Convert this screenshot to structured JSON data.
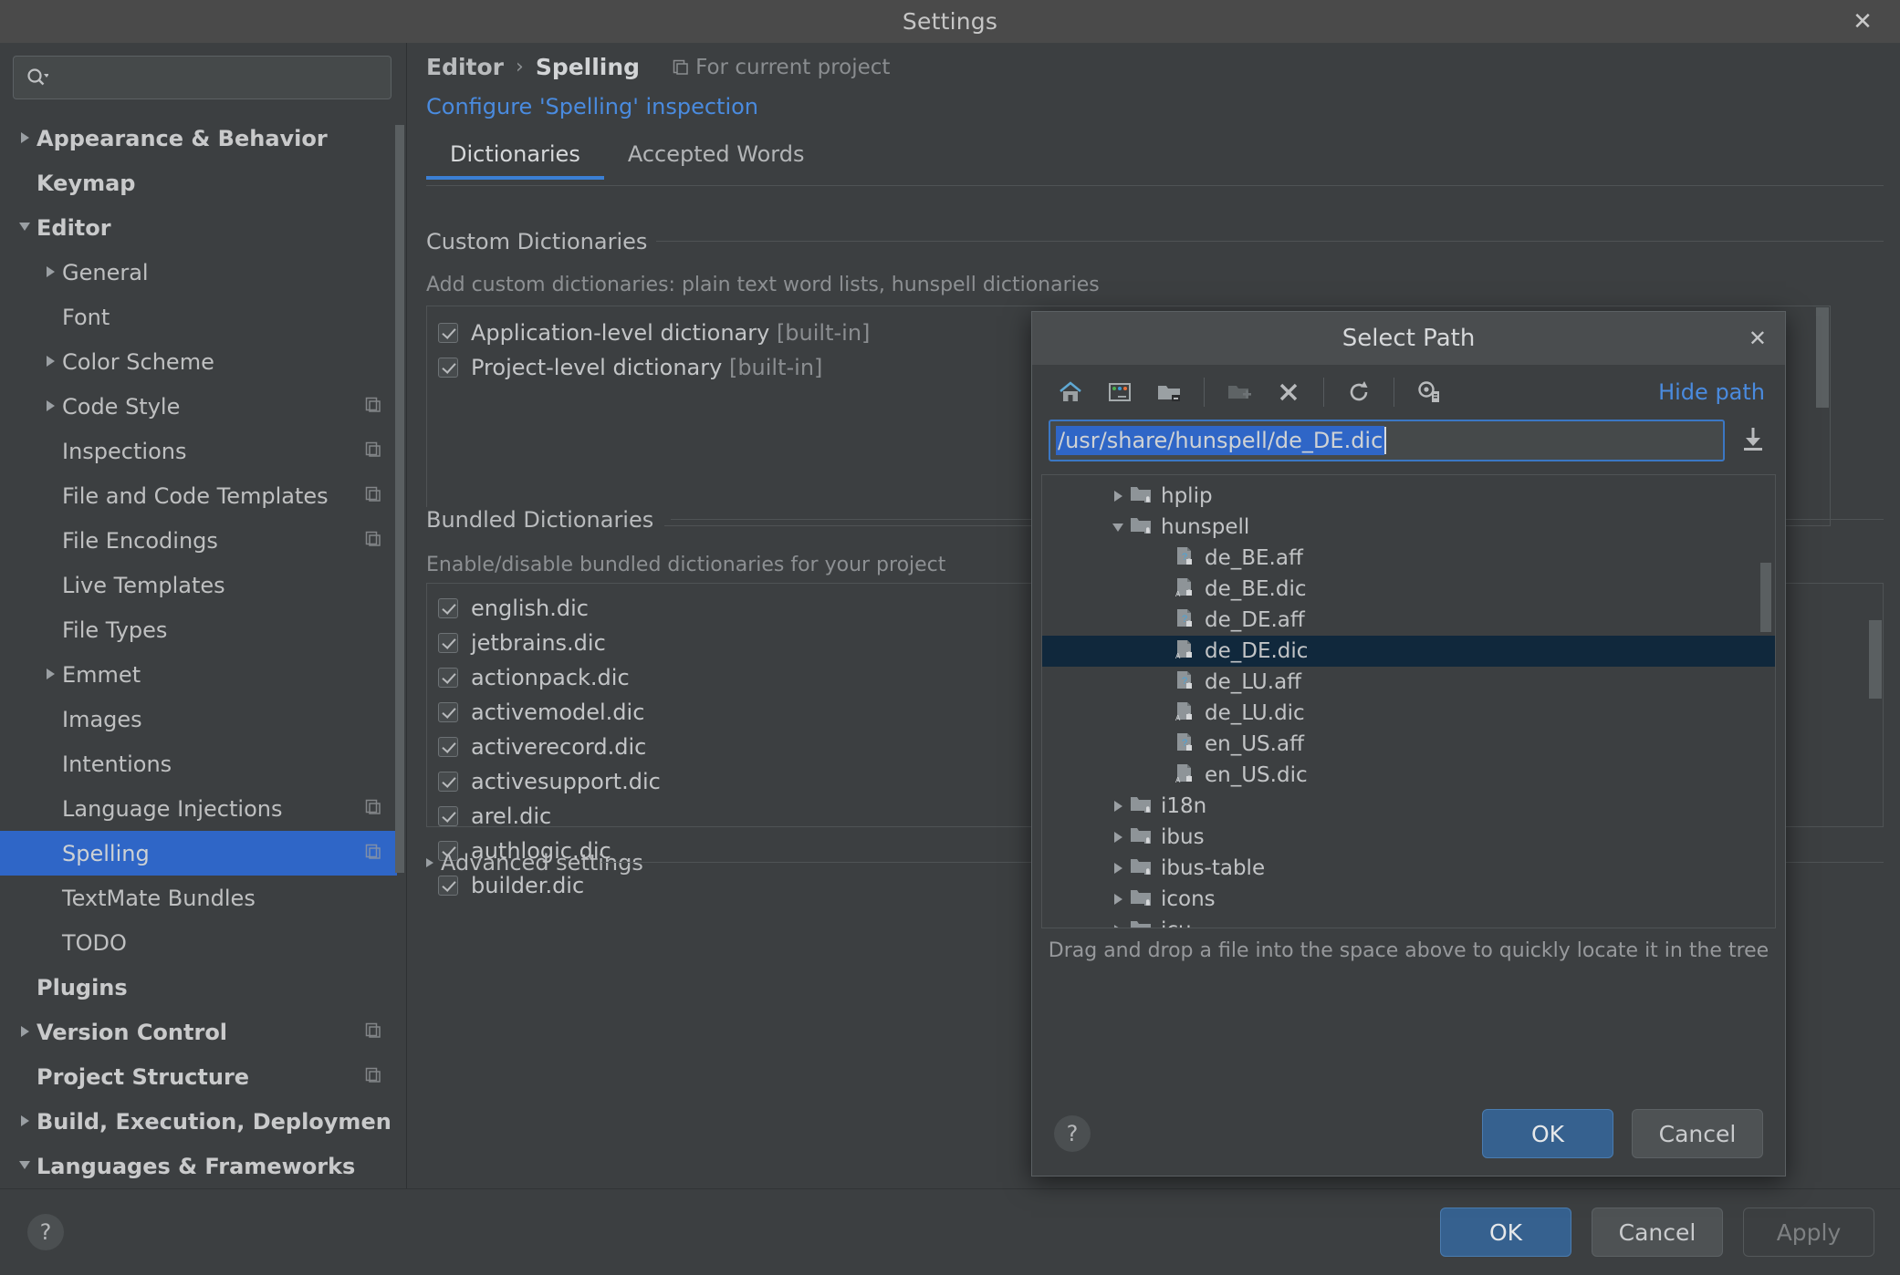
{
  "window": {
    "title": "Settings",
    "close_label": "✕"
  },
  "search": {
    "placeholder": "",
    "value": "",
    "icon": "search-icon"
  },
  "sidebar": {
    "items": [
      {
        "label": "Appearance & Behavior",
        "level": 0,
        "arrow": "closed",
        "copy": false,
        "selected": false
      },
      {
        "label": "Keymap",
        "level": 0,
        "arrow": "none",
        "copy": false,
        "selected": false
      },
      {
        "label": "Editor",
        "level": 0,
        "arrow": "open",
        "copy": false,
        "selected": false
      },
      {
        "label": "General",
        "level": 1,
        "arrow": "closed",
        "copy": false,
        "selected": false
      },
      {
        "label": "Font",
        "level": 1,
        "arrow": "none",
        "copy": false,
        "selected": false
      },
      {
        "label": "Color Scheme",
        "level": 1,
        "arrow": "closed",
        "copy": false,
        "selected": false
      },
      {
        "label": "Code Style",
        "level": 1,
        "arrow": "closed",
        "copy": true,
        "selected": false
      },
      {
        "label": "Inspections",
        "level": 1,
        "arrow": "none",
        "copy": true,
        "selected": false
      },
      {
        "label": "File and Code Templates",
        "level": 1,
        "arrow": "none",
        "copy": true,
        "selected": false
      },
      {
        "label": "File Encodings",
        "level": 1,
        "arrow": "none",
        "copy": true,
        "selected": false
      },
      {
        "label": "Live Templates",
        "level": 1,
        "arrow": "none",
        "copy": false,
        "selected": false
      },
      {
        "label": "File Types",
        "level": 1,
        "arrow": "none",
        "copy": false,
        "selected": false
      },
      {
        "label": "Emmet",
        "level": 1,
        "arrow": "closed",
        "copy": false,
        "selected": false
      },
      {
        "label": "Images",
        "level": 1,
        "arrow": "none",
        "copy": false,
        "selected": false
      },
      {
        "label": "Intentions",
        "level": 1,
        "arrow": "none",
        "copy": false,
        "selected": false
      },
      {
        "label": "Language Injections",
        "level": 1,
        "arrow": "none",
        "copy": true,
        "selected": false
      },
      {
        "label": "Spelling",
        "level": 1,
        "arrow": "none",
        "copy": true,
        "selected": true
      },
      {
        "label": "TextMate Bundles",
        "level": 1,
        "arrow": "none",
        "copy": false,
        "selected": false
      },
      {
        "label": "TODO",
        "level": 1,
        "arrow": "none",
        "copy": false,
        "selected": false
      },
      {
        "label": "Plugins",
        "level": 0,
        "arrow": "none",
        "copy": false,
        "selected": false
      },
      {
        "label": "Version Control",
        "level": 0,
        "arrow": "closed",
        "copy": true,
        "selected": false
      },
      {
        "label": "Project Structure",
        "level": 0,
        "arrow": "none",
        "copy": true,
        "selected": false
      },
      {
        "label": "Build, Execution, Deploymen",
        "level": 0,
        "arrow": "closed",
        "copy": false,
        "selected": false
      },
      {
        "label": "Languages & Frameworks",
        "level": 0,
        "arrow": "open",
        "copy": false,
        "selected": false
      }
    ]
  },
  "main": {
    "breadcrumb": {
      "parent": "Editor",
      "separator": "›",
      "current": "Spelling"
    },
    "for_current_project": "For current project",
    "configure_link": "Configure 'Spelling' inspection",
    "tabs": [
      {
        "label": "Dictionaries",
        "active": true
      },
      {
        "label": "Accepted Words",
        "active": false
      }
    ],
    "custom_dictionaries": {
      "title": "Custom Dictionaries",
      "hint": "Add custom dictionaries: plain text word lists, hunspell dictionaries",
      "items": [
        {
          "name": "Application-level dictionary",
          "suffix": " [built-in]",
          "checked": true
        },
        {
          "name": "Project-level dictionary",
          "suffix": " [built-in]",
          "checked": true
        }
      ],
      "buttons": [
        {
          "icon": "plus-icon",
          "glyph": "+",
          "selected": true
        },
        {
          "icon": "minus-icon",
          "glyph": "–",
          "selected": false
        },
        {
          "icon": "pencil-icon",
          "glyph": "✎",
          "selected": false
        }
      ]
    },
    "bundled_dictionaries": {
      "title": "Bundled Dictionaries",
      "hint": "Enable/disable bundled dictionaries for your project",
      "items": [
        {
          "name": "english.dic",
          "checked": true
        },
        {
          "name": "jetbrains.dic",
          "checked": true
        },
        {
          "name": "actionpack.dic",
          "checked": true
        },
        {
          "name": "activemodel.dic",
          "checked": true
        },
        {
          "name": "activerecord.dic",
          "checked": true
        },
        {
          "name": "activesupport.dic",
          "checked": true
        },
        {
          "name": "arel.dic",
          "checked": true
        },
        {
          "name": "authlogic.dic",
          "checked": true
        },
        {
          "name": "builder.dic",
          "checked": true
        }
      ]
    },
    "advanced_settings": "Advanced settings"
  },
  "footer": {
    "help_label": "?",
    "ok": "OK",
    "cancel": "Cancel",
    "apply": "Apply"
  },
  "dialog": {
    "title": "Select Path",
    "close_label": "✕",
    "toolbar": [
      {
        "icon": "home-icon",
        "name": "home-directory-button"
      },
      {
        "icon": "desktop-icon",
        "name": "desktop-directory-button"
      },
      {
        "icon": "project-folder-icon",
        "name": "project-directory-button"
      },
      {
        "icon": "new-folder-icon",
        "name": "new-folder-button"
      },
      {
        "icon": "delete-icon",
        "name": "delete-button"
      },
      {
        "icon": "refresh-icon",
        "name": "refresh-button"
      },
      {
        "icon": "show-hidden-icon",
        "name": "show-hidden-files-button"
      }
    ],
    "hide_path_label": "Hide path",
    "path_value": "/usr/share/hunspell/de_DE.dic",
    "download_icon": "download-icon",
    "tree": [
      {
        "name": "hplip",
        "type": "folder",
        "arrow": "closed",
        "indent": 1,
        "selected": false
      },
      {
        "name": "hunspell",
        "type": "folder",
        "arrow": "open",
        "indent": 1,
        "selected": false
      },
      {
        "name": "de_BE.aff",
        "type": "file-aff",
        "arrow": "none",
        "indent": 2,
        "selected": false
      },
      {
        "name": "de_BE.dic",
        "type": "file-dic",
        "arrow": "none",
        "indent": 2,
        "selected": false
      },
      {
        "name": "de_DE.aff",
        "type": "file-aff",
        "arrow": "none",
        "indent": 2,
        "selected": false
      },
      {
        "name": "de_DE.dic",
        "type": "file-dic",
        "arrow": "none",
        "indent": 2,
        "selected": true
      },
      {
        "name": "de_LU.aff",
        "type": "file-aff",
        "arrow": "none",
        "indent": 2,
        "selected": false
      },
      {
        "name": "de_LU.dic",
        "type": "file-dic",
        "arrow": "none",
        "indent": 2,
        "selected": false
      },
      {
        "name": "en_US.aff",
        "type": "file-aff",
        "arrow": "none",
        "indent": 2,
        "selected": false
      },
      {
        "name": "en_US.dic",
        "type": "file-dic",
        "arrow": "none",
        "indent": 2,
        "selected": false
      },
      {
        "name": "i18n",
        "type": "folder",
        "arrow": "closed",
        "indent": 1,
        "selected": false
      },
      {
        "name": "ibus",
        "type": "folder",
        "arrow": "closed",
        "indent": 1,
        "selected": false
      },
      {
        "name": "ibus-table",
        "type": "folder",
        "arrow": "closed",
        "indent": 1,
        "selected": false
      },
      {
        "name": "icons",
        "type": "folder",
        "arrow": "closed",
        "indent": 1,
        "selected": false
      },
      {
        "name": "icu",
        "type": "folder",
        "arrow": "closed",
        "indent": 1,
        "selected": false
      }
    ],
    "drag_hint": "Drag and drop a file into the space above to quickly locate it in the tree",
    "help_label": "?",
    "ok": "OK",
    "cancel": "Cancel"
  },
  "colors": {
    "accent_blue": "#2f66c7",
    "link_blue": "#4a8bdf",
    "bg": "#3c3f41",
    "titlebar": "#4a4d4f",
    "tree_selection": "#10283c",
    "primary_button": "#36618f"
  }
}
